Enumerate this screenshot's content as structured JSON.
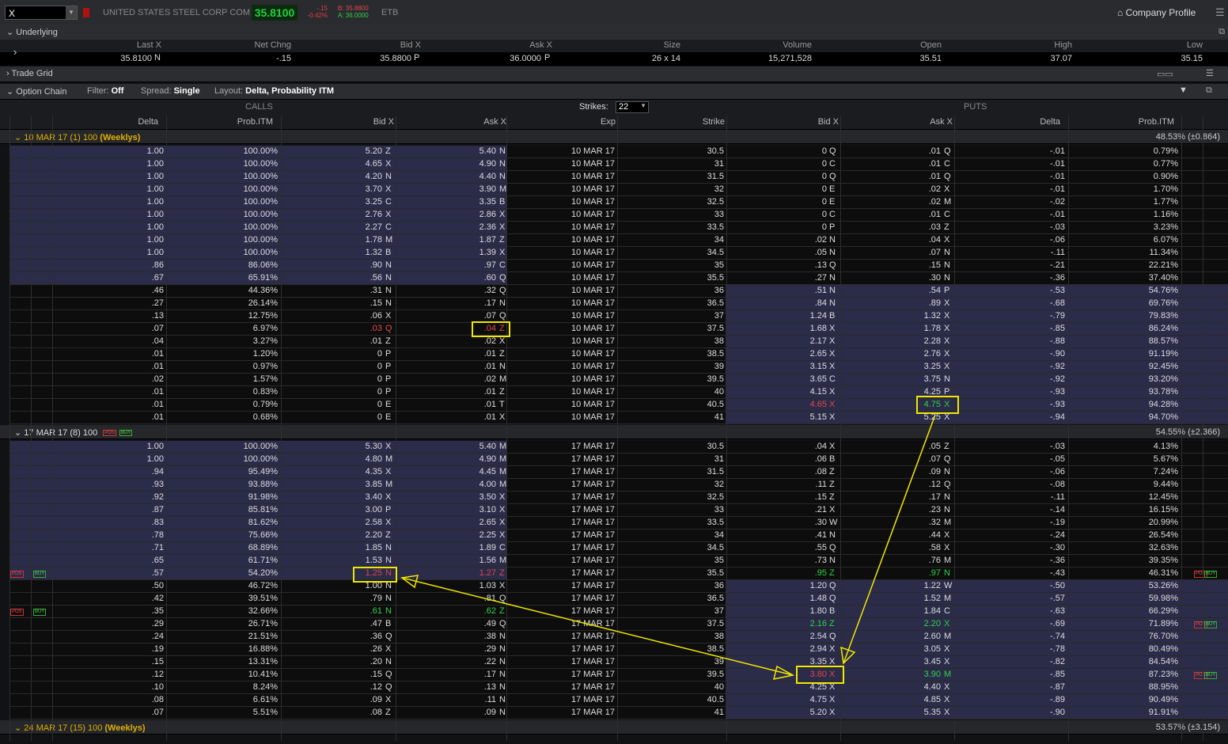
{
  "topbar": {
    "symbol": "X",
    "company": "UNITED STATES STEEL CORP COM",
    "last": "35.8100",
    "net_chg": "-.15",
    "net_chg_pct": "-0.42%",
    "bid": "B: 35.8800",
    "ask": "A: 36.0000",
    "etb": "ETB",
    "company_profile": "Company Profile"
  },
  "underlying": {
    "title": "Underlying",
    "headers": [
      "Last X",
      "Net Chng",
      "Bid X",
      "Ask X",
      "Size",
      "Volume",
      "Open",
      "High",
      "Low"
    ],
    "values": {
      "last": "35.8100",
      "last_ex": "N",
      "net_chng": "-.15",
      "bid": "35.8800",
      "bid_ex": "P",
      "ask": "36.0000",
      "ask_ex": "P",
      "size": "26 x 14",
      "volume": "15,271,528",
      "open": "35.51",
      "high": "37.07",
      "low": "35.15"
    }
  },
  "trade_grid": {
    "title": "Trade Grid"
  },
  "option_chain": {
    "title": "Option Chain",
    "filter_label": "Filter:",
    "filter_value": "Off",
    "spread_label": "Spread:",
    "spread_value": "Single",
    "layout_label": "Layout:",
    "layout_value": "Delta, Probability ITM"
  },
  "chain": {
    "calls_label": "CALLS",
    "puts_label": "PUTS",
    "strikes_label": "Strikes:",
    "strikes_value": "22",
    "columns": {
      "delta": "Delta",
      "prob": "Prob.ITM",
      "bid": "Bid X",
      "ask": "Ask X",
      "exp": "Exp",
      "strike": "Strike",
      "pbid": "Bid X",
      "pask": "Ask X",
      "pdelta": "Delta",
      "pprob": "Prob.ITM"
    }
  },
  "expirations": [
    {
      "date": "10 MAR 17",
      "count": "(1)",
      "mult": "100",
      "tag": "(Weeklys)",
      "right": "48.53% (±0.864)",
      "style": "yellow",
      "rows": [
        [
          "1.00",
          "100.00%",
          "5.20",
          "Z",
          "5.40",
          "N",
          "10 MAR 17",
          "30.5",
          "0",
          "Q",
          ".01",
          "Q",
          "-.01",
          "0.79%"
        ],
        [
          "1.00",
          "100.00%",
          "4.65",
          "X",
          "4.90",
          "N",
          "10 MAR 17",
          "31",
          "0",
          "C",
          ".01",
          "C",
          "-.01",
          "0.77%"
        ],
        [
          "1.00",
          "100.00%",
          "4.20",
          "N",
          "4.40",
          "N",
          "10 MAR 17",
          "31.5",
          "0",
          "Q",
          ".01",
          "Q",
          "-.01",
          "0.90%"
        ],
        [
          "1.00",
          "100.00%",
          "3.70",
          "X",
          "3.90",
          "M",
          "10 MAR 17",
          "32",
          "0",
          "E",
          ".02",
          "X",
          "-.01",
          "1.70%"
        ],
        [
          "1.00",
          "100.00%",
          "3.25",
          "C",
          "3.35",
          "B",
          "10 MAR 17",
          "32.5",
          "0",
          "E",
          ".02",
          "M",
          "-.02",
          "1.77%"
        ],
        [
          "1.00",
          "100.00%",
          "2.76",
          "X",
          "2.86",
          "X",
          "10 MAR 17",
          "33",
          "0",
          "C",
          ".01",
          "C",
          "-.01",
          "1.16%"
        ],
        [
          "1.00",
          "100.00%",
          "2.27",
          "C",
          "2.36",
          "X",
          "10 MAR 17",
          "33.5",
          "0",
          "P",
          ".03",
          "Z",
          "-.03",
          "3.23%"
        ],
        [
          "1.00",
          "100.00%",
          "1.78",
          "M",
          "1.87",
          "Z",
          "10 MAR 17",
          "34",
          ".02",
          "N",
          ".04",
          "X",
          "-.06",
          "6.07%"
        ],
        [
          "1.00",
          "100.00%",
          "1.32",
          "B",
          "1.39",
          "X",
          "10 MAR 17",
          "34.5",
          ".05",
          "N",
          ".07",
          "N",
          "-.11",
          "11.34%"
        ],
        [
          ".86",
          "86.06%",
          ".90",
          "N",
          ".97",
          "C",
          "10 MAR 17",
          "35",
          ".13",
          "Q",
          ".15",
          "N",
          "-.21",
          "22.21%"
        ],
        [
          ".67",
          "65.91%",
          ".56",
          "N",
          ".60",
          "Q",
          "10 MAR 17",
          "35.5",
          ".27",
          "N",
          ".30",
          "N",
          "-.36",
          "37.40%"
        ],
        [
          ".46",
          "44.36%",
          ".31",
          "N",
          ".32",
          "Q",
          "10 MAR 17",
          "36",
          ".51",
          "N",
          ".54",
          "P",
          "-.53",
          "54.76%"
        ],
        [
          ".27",
          "26.14%",
          ".15",
          "N",
          ".17",
          "N",
          "10 MAR 17",
          "36.5",
          ".84",
          "N",
          ".89",
          "X",
          "-.68",
          "69.76%"
        ],
        [
          ".13",
          "12.75%",
          ".06",
          "X",
          ".07",
          "Q",
          "10 MAR 17",
          "37",
          "1.24",
          "B",
          "1.32",
          "X",
          "-.79",
          "79.83%"
        ],
        [
          ".07",
          "6.97%",
          ".03",
          "Q",
          ".04",
          "Z",
          "10 MAR 17",
          "37.5",
          "1.68",
          "X",
          "1.78",
          "X",
          "-.85",
          "86.24%"
        ],
        [
          ".04",
          "3.27%",
          ".01",
          "Z",
          ".02",
          "X",
          "10 MAR 17",
          "38",
          "2.17",
          "X",
          "2.28",
          "X",
          "-.88",
          "88.57%"
        ],
        [
          ".01",
          "1.20%",
          "0",
          "P",
          ".01",
          "Z",
          "10 MAR 17",
          "38.5",
          "2.65",
          "X",
          "2.76",
          "X",
          "-.90",
          "91.19%"
        ],
        [
          ".01",
          "0.97%",
          "0",
          "P",
          ".01",
          "N",
          "10 MAR 17",
          "39",
          "3.15",
          "X",
          "3.25",
          "X",
          "-.92",
          "92.45%"
        ],
        [
          ".02",
          "1.57%",
          "0",
          "P",
          ".02",
          "M",
          "10 MAR 17",
          "39.5",
          "3.65",
          "C",
          "3.75",
          "N",
          "-.92",
          "93.20%"
        ],
        [
          ".01",
          "0.83%",
          "0",
          "P",
          ".01",
          "Z",
          "10 MAR 17",
          "40",
          "4.15",
          "X",
          "4.25",
          "P",
          "-.93",
          "93.78%"
        ],
        [
          ".01",
          "0.79%",
          "0",
          "E",
          ".01",
          "T",
          "10 MAR 17",
          "40.5",
          "4.65",
          "X",
          "4.75",
          "X",
          "-.93",
          "94.28%"
        ],
        [
          ".01",
          "0.68%",
          "0",
          "E",
          ".01",
          "X",
          "10 MAR 17",
          "41",
          "5.15",
          "X",
          "5.25",
          "X",
          "-.94",
          "94.70%"
        ]
      ]
    },
    {
      "date": "17 MAR 17",
      "count": "(8)",
      "mult": "100",
      "tag": "",
      "right": "54.55% (±2.366)",
      "style": "white",
      "rows": [
        [
          "1.00",
          "100.00%",
          "5.30",
          "X",
          "5.40",
          "M",
          "17 MAR 17",
          "30.5",
          ".04",
          "X",
          ".05",
          "Z",
          "-.03",
          "4.13%"
        ],
        [
          "1.00",
          "100.00%",
          "4.80",
          "M",
          "4.90",
          "M",
          "17 MAR 17",
          "31",
          ".06",
          "B",
          ".07",
          "Q",
          "-.05",
          "5.67%"
        ],
        [
          ".94",
          "95.49%",
          "4.35",
          "X",
          "4.45",
          "M",
          "17 MAR 17",
          "31.5",
          ".08",
          "Z",
          ".09",
          "N",
          "-.06",
          "7.24%"
        ],
        [
          ".93",
          "93.88%",
          "3.85",
          "M",
          "4.00",
          "M",
          "17 MAR 17",
          "32",
          ".11",
          "Z",
          ".12",
          "Q",
          "-.08",
          "9.44%"
        ],
        [
          ".92",
          "91.98%",
          "3.40",
          "X",
          "3.50",
          "X",
          "17 MAR 17",
          "32.5",
          ".15",
          "Z",
          ".17",
          "N",
          "-.11",
          "12.45%"
        ],
        [
          ".87",
          "85.81%",
          "3.00",
          "P",
          "3.10",
          "X",
          "17 MAR 17",
          "33",
          ".21",
          "X",
          ".23",
          "N",
          "-.14",
          "16.15%"
        ],
        [
          ".83",
          "81.62%",
          "2.58",
          "X",
          "2.65",
          "X",
          "17 MAR 17",
          "33.5",
          ".30",
          "W",
          ".32",
          "M",
          "-.19",
          "20.99%"
        ],
        [
          ".78",
          "75.66%",
          "2.20",
          "Z",
          "2.25",
          "X",
          "17 MAR 17",
          "34",
          ".41",
          "N",
          ".44",
          "X",
          "-.24",
          "26.54%"
        ],
        [
          ".71",
          "68.89%",
          "1.85",
          "N",
          "1.89",
          "C",
          "17 MAR 17",
          "34.5",
          ".55",
          "Q",
          ".58",
          "X",
          "-.30",
          "32.63%"
        ],
        [
          ".65",
          "61.71%",
          "1.53",
          "N",
          "1.56",
          "M",
          "17 MAR 17",
          "35",
          ".73",
          "N",
          ".76",
          "M",
          "-.36",
          "39.35%"
        ],
        [
          ".57",
          "54.20%",
          "1.25",
          "N",
          "1.27",
          "Z",
          "17 MAR 17",
          "35.5",
          ".95",
          "Z",
          ".97",
          "N",
          "-.43",
          "46.31%"
        ],
        [
          ".50",
          "46.72%",
          "1.00",
          "N",
          "1.03",
          "X",
          "17 MAR 17",
          "36",
          "1.20",
          "Q",
          "1.22",
          "W",
          "-.50",
          "53.26%"
        ],
        [
          ".42",
          "39.51%",
          ".79",
          "N",
          ".81",
          "Q",
          "17 MAR 17",
          "36.5",
          "1.48",
          "Q",
          "1.52",
          "M",
          "-.57",
          "59.98%"
        ],
        [
          ".35",
          "32.66%",
          ".61",
          "N",
          ".62",
          "Z",
          "17 MAR 17",
          "37",
          "1.80",
          "B",
          "1.84",
          "C",
          "-.63",
          "66.29%"
        ],
        [
          ".29",
          "26.71%",
          ".47",
          "B",
          ".49",
          "Q",
          "17 MAR 17",
          "37.5",
          "2.16",
          "Z",
          "2.20",
          "X",
          "-.69",
          "71.89%"
        ],
        [
          ".24",
          "21.51%",
          ".36",
          "Q",
          ".38",
          "N",
          "17 MAR 17",
          "38",
          "2.54",
          "Q",
          "2.60",
          "M",
          "-.74",
          "76.70%"
        ],
        [
          ".19",
          "16.88%",
          ".26",
          "X",
          ".29",
          "N",
          "17 MAR 17",
          "38.5",
          "2.94",
          "X",
          "3.05",
          "X",
          "-.78",
          "80.49%"
        ],
        [
          ".15",
          "13.31%",
          ".20",
          "N",
          ".22",
          "N",
          "17 MAR 17",
          "39",
          "3.35",
          "X",
          "3.45",
          "X",
          "-.82",
          "84.54%"
        ],
        [
          ".12",
          "10.41%",
          ".15",
          "Q",
          ".17",
          "N",
          "17 MAR 17",
          "39.5",
          "3.80",
          "X",
          "3.90",
          "M",
          "-.85",
          "87.23%"
        ],
        [
          ".10",
          "8.24%",
          ".12",
          "Q",
          ".13",
          "N",
          "17 MAR 17",
          "40",
          "4.25",
          "X",
          "4.40",
          "X",
          "-.87",
          "88.95%"
        ],
        [
          ".08",
          "6.61%",
          ".09",
          "X",
          ".11",
          "N",
          "17 MAR 17",
          "40.5",
          "4.75",
          "X",
          "4.85",
          "X",
          "-.89",
          "90.49%"
        ],
        [
          ".07",
          "5.51%",
          ".08",
          "Z",
          ".09",
          "N",
          "17 MAR 17",
          "41",
          "5.20",
          "X",
          "5.35",
          "X",
          "-.90",
          "91.91%"
        ]
      ]
    },
    {
      "date": "24 MAR 17",
      "count": "(15)",
      "mult": "100",
      "tag": "(Weeklys)",
      "right": "53.57% (±3.154)",
      "style": "yellow",
      "rows": []
    }
  ],
  "badges": {
    "pos": "POS",
    "buy": "BUY"
  },
  "colors": {
    "last_bg": "#0d2a10",
    "green": "#2fd24a",
    "red": "#e04848",
    "itm_bg": "#2b2b4a",
    "highlight": "#f0e800"
  }
}
